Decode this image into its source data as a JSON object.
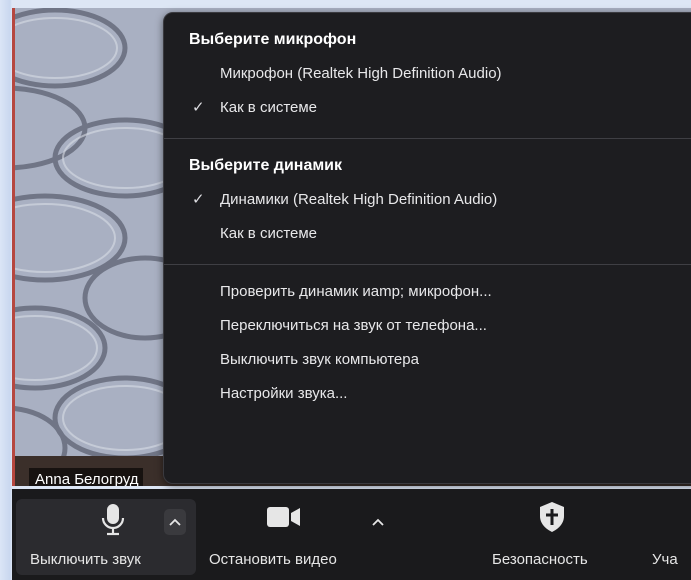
{
  "participant": {
    "name": "Anna Белогруд"
  },
  "audio_menu": {
    "microphone_section": {
      "header": "Выберите микрофон",
      "items": [
        {
          "label": "Микрофон (Realtek High Definition Audio)",
          "checked": false
        },
        {
          "label": "Как в системе",
          "checked": true
        }
      ]
    },
    "speaker_section": {
      "header": "Выберите динамик",
      "items": [
        {
          "label": "Динамики (Realtek High Definition Audio)",
          "checked": true
        },
        {
          "label": "Как в системе",
          "checked": false
        }
      ]
    },
    "actions": [
      "Проверить динамик иamp; микрофон...",
      "Переключиться на звук от телефона...",
      "Выключить звук компьютера",
      "Настройки звука..."
    ],
    "check_glyph": "✓"
  },
  "toolbar": {
    "mute_label": "Выключить звук",
    "video_label": "Остановить видео",
    "security_label": "Безопасность",
    "participants_label": "Уча"
  },
  "icons": {
    "microphone": "microphone-icon",
    "camera": "video-camera-icon",
    "shield": "shield-icon",
    "caret": "chevron-up-icon",
    "check": "checkmark-icon"
  },
  "colors": {
    "menu_bg": "#1d1d20",
    "toolbar_bg": "#1a1a1c",
    "text": "#ececef"
  }
}
